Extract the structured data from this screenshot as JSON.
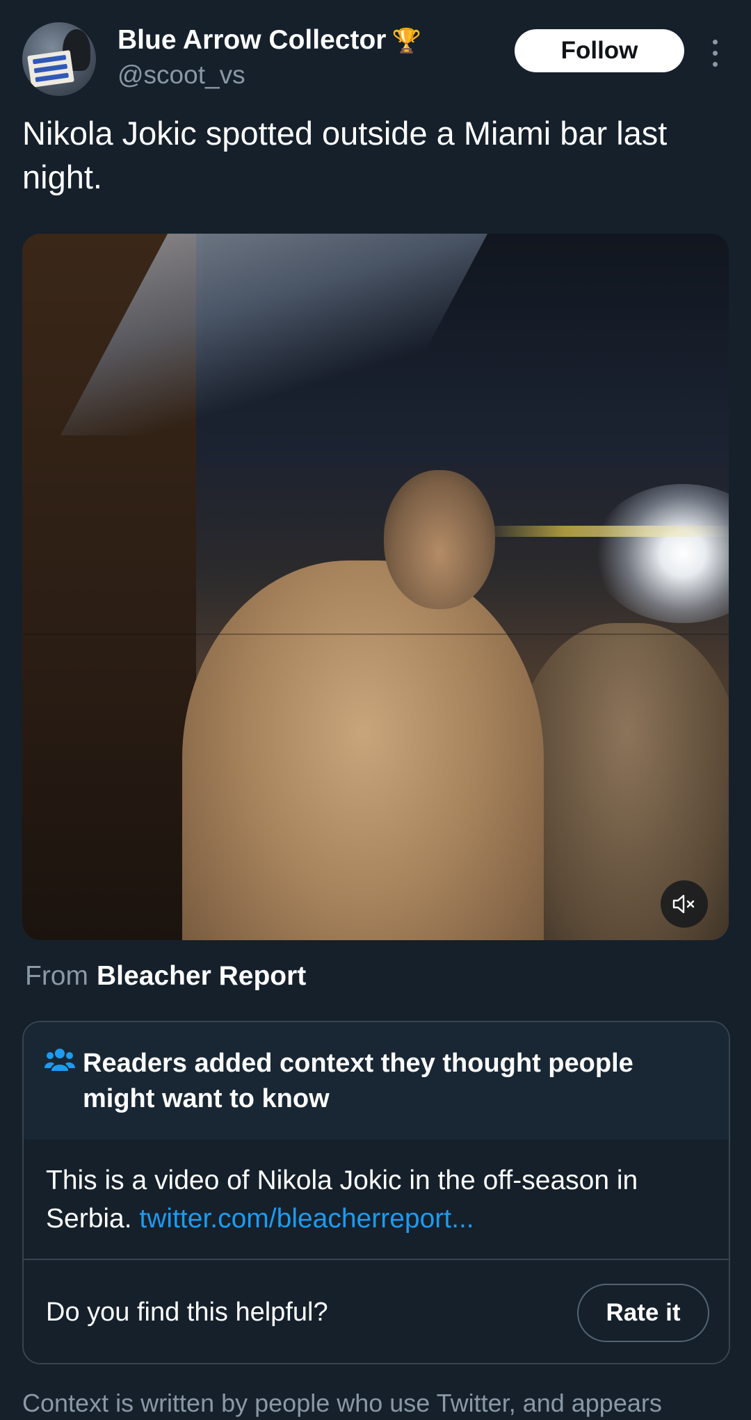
{
  "tweet": {
    "display_name": "Blue Arrow Collector",
    "handle": "@scoot_vs",
    "follow_label": "Follow",
    "text": "Nikola Jokic spotted outside a Miami bar last night."
  },
  "icons": {
    "badge": "trophy-icon",
    "more": "more-options-icon",
    "mute": "mute-icon",
    "notes": "people-icon"
  },
  "source": {
    "prefix": "From",
    "name": "Bleacher Report"
  },
  "community_note": {
    "title": "Readers added context they thought people might want to know",
    "body": "This is a video of Nikola Jokic in the off-season in Serbia.",
    "link_text": "twitter.com/bleacherreport...",
    "question": "Do you find this helpful?",
    "rate_label": "Rate it"
  },
  "disclaimer": "Context is written by people who use Twitter, and appears",
  "colors": {
    "background": "#15202b",
    "accent": "#1d9bf0",
    "secondary_text": "#8b98a5",
    "border": "#38444d"
  }
}
